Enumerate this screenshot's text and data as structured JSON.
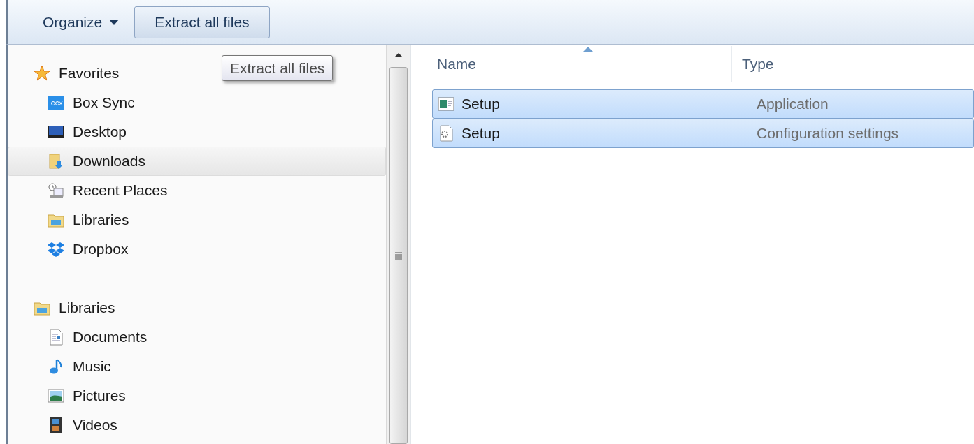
{
  "toolbar": {
    "organize": "Organize",
    "extract_button": "Extract all files"
  },
  "tooltip": "Extract all files",
  "navigation": [
    {
      "label": "Favorites",
      "selected": false,
      "children": [
        {
          "label": "Box Sync",
          "selected": false
        },
        {
          "label": "Desktop",
          "selected": false
        },
        {
          "label": "Downloads",
          "selected": true
        },
        {
          "label": "Recent Places",
          "selected": false
        },
        {
          "label": "Libraries",
          "selected": false
        },
        {
          "label": "Dropbox",
          "selected": false
        }
      ]
    },
    {
      "label": "Libraries",
      "selected": false,
      "children": [
        {
          "label": "Documents",
          "selected": false
        },
        {
          "label": "Music",
          "selected": false
        },
        {
          "label": "Pictures",
          "selected": false
        },
        {
          "label": "Videos",
          "selected": false
        }
      ]
    }
  ],
  "file_list": {
    "columns": [
      "Name",
      "Type"
    ],
    "rows": [
      {
        "name": "Setup",
        "type": "Application",
        "selected": true
      },
      {
        "name": "Setup",
        "type": "Configuration settings",
        "selected": true
      }
    ]
  }
}
